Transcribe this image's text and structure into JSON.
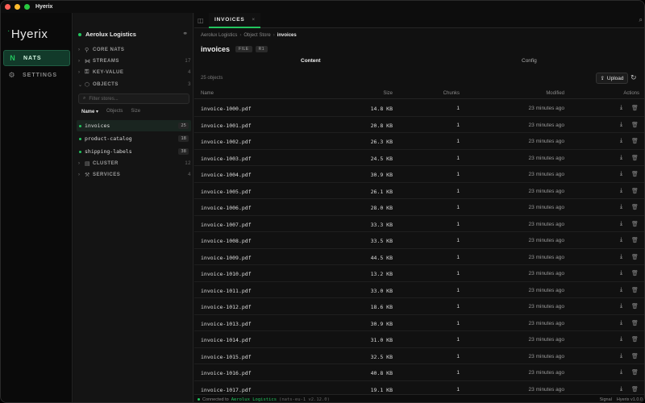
{
  "app": {
    "title": "Hyerix",
    "logo": "Hyerix"
  },
  "rail": {
    "items": [
      {
        "label": "NATS",
        "icon": "N"
      },
      {
        "label": "SETTINGS",
        "icon": "⚙"
      }
    ]
  },
  "sidebar": {
    "workspace": "Aerolux Logistics",
    "sections": [
      {
        "label": "CORE NATS",
        "icon": "⚲",
        "count": ""
      },
      {
        "label": "STREAMS",
        "icon": "⋈",
        "count": "17"
      },
      {
        "label": "KEY-VALUE",
        "icon": "⚿",
        "count": "4"
      },
      {
        "label": "OBJECTS",
        "icon": "⬡",
        "count": "3"
      }
    ],
    "filter_placeholder": "Filter stores...",
    "sort": {
      "name": "Name ▾",
      "objects": "Objects",
      "size": "Size"
    },
    "stores": [
      {
        "name": "invoices",
        "count": "25"
      },
      {
        "name": "product-catalog",
        "count": "18"
      },
      {
        "name": "shipping-labels",
        "count": "38"
      }
    ],
    "sections2": [
      {
        "label": "CLUSTER",
        "icon": "▤",
        "count": "12"
      },
      {
        "label": "SERVICES",
        "icon": "⚒",
        "count": "4"
      }
    ]
  },
  "tabs": [
    {
      "label": "INVOICES"
    }
  ],
  "breadcrumb": [
    "Aerolux Logistics",
    "Object Store",
    "invoices"
  ],
  "store": {
    "name": "invoices",
    "badges": [
      "FILE",
      "R1"
    ]
  },
  "subtabs": [
    "Content",
    "Config"
  ],
  "toolbar": {
    "count": "25 objects",
    "upload": "Upload"
  },
  "table": {
    "headers": {
      "name": "Name",
      "size": "Size",
      "chunks": "Chunks",
      "modified": "Modified",
      "actions": "Actions"
    },
    "rows": [
      {
        "name": "invoice-1000.pdf",
        "size": "14.8 KB",
        "chunks": "1",
        "modified": "23 minutes ago"
      },
      {
        "name": "invoice-1001.pdf",
        "size": "20.8 KB",
        "chunks": "1",
        "modified": "23 minutes ago"
      },
      {
        "name": "invoice-1002.pdf",
        "size": "26.3 KB",
        "chunks": "1",
        "modified": "23 minutes ago"
      },
      {
        "name": "invoice-1003.pdf",
        "size": "24.5 KB",
        "chunks": "1",
        "modified": "23 minutes ago"
      },
      {
        "name": "invoice-1004.pdf",
        "size": "30.9 KB",
        "chunks": "1",
        "modified": "23 minutes ago"
      },
      {
        "name": "invoice-1005.pdf",
        "size": "26.1 KB",
        "chunks": "1",
        "modified": "23 minutes ago"
      },
      {
        "name": "invoice-1006.pdf",
        "size": "28.0 KB",
        "chunks": "1",
        "modified": "23 minutes ago"
      },
      {
        "name": "invoice-1007.pdf",
        "size": "33.3 KB",
        "chunks": "1",
        "modified": "23 minutes ago"
      },
      {
        "name": "invoice-1008.pdf",
        "size": "33.5 KB",
        "chunks": "1",
        "modified": "23 minutes ago"
      },
      {
        "name": "invoice-1009.pdf",
        "size": "44.5 KB",
        "chunks": "1",
        "modified": "23 minutes ago"
      },
      {
        "name": "invoice-1010.pdf",
        "size": "13.2 KB",
        "chunks": "1",
        "modified": "23 minutes ago"
      },
      {
        "name": "invoice-1011.pdf",
        "size": "33.0 KB",
        "chunks": "1",
        "modified": "23 minutes ago"
      },
      {
        "name": "invoice-1012.pdf",
        "size": "18.6 KB",
        "chunks": "1",
        "modified": "23 minutes ago"
      },
      {
        "name": "invoice-1013.pdf",
        "size": "30.9 KB",
        "chunks": "1",
        "modified": "23 minutes ago"
      },
      {
        "name": "invoice-1014.pdf",
        "size": "31.0 KB",
        "chunks": "1",
        "modified": "23 minutes ago"
      },
      {
        "name": "invoice-1015.pdf",
        "size": "32.5 KB",
        "chunks": "1",
        "modified": "23 minutes ago"
      },
      {
        "name": "invoice-1016.pdf",
        "size": "40.8 KB",
        "chunks": "1",
        "modified": "23 minutes ago"
      },
      {
        "name": "invoice-1017.pdf",
        "size": "19.1 KB",
        "chunks": "1",
        "modified": "23 minutes ago"
      }
    ]
  },
  "status": {
    "connected_prefix": "Connected to",
    "server": "Aerolux Logistics",
    "server_meta": "(nats-eu-1 v2.12.0)",
    "signal": "Signal",
    "version": "Hyerix v1.0.0"
  },
  "colors": {
    "accent": "#22c55e",
    "background": "#111111"
  }
}
